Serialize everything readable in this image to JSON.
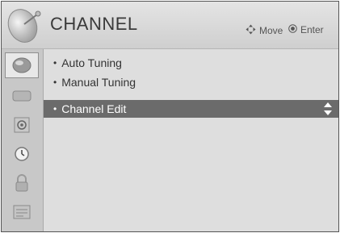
{
  "header": {
    "title": "CHANNEL",
    "hints": [
      {
        "icon": "four-way-arrows-icon",
        "label": "Move"
      },
      {
        "icon": "ok-button-icon",
        "label": "Enter"
      }
    ]
  },
  "sidebar": {
    "items": [
      {
        "icon": "picture-icon",
        "active": true
      },
      {
        "icon": "audio-icon",
        "active": false
      },
      {
        "icon": "setup-icon",
        "active": false
      },
      {
        "icon": "clock-icon",
        "active": false
      },
      {
        "icon": "lock-icon",
        "active": false
      },
      {
        "icon": "option-icon",
        "active": false
      }
    ]
  },
  "menu": {
    "items": [
      {
        "label": "Auto Tuning",
        "selected": false
      },
      {
        "label": "Manual Tuning",
        "selected": false
      },
      {
        "label": "Channel Edit",
        "selected": true
      }
    ]
  },
  "colors": {
    "selection_bar": "#6b6b6b",
    "panel_background": "#d9d9d9"
  }
}
